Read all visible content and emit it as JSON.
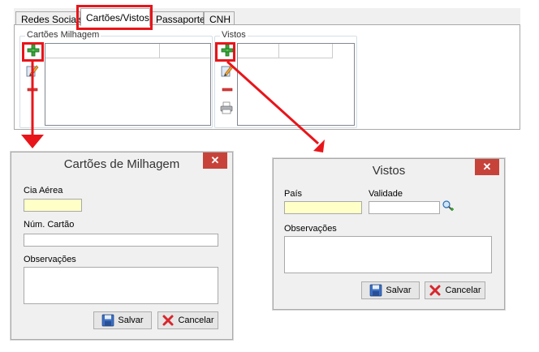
{
  "tabs": [
    {
      "label": "Redes Sociais"
    },
    {
      "label": "Cartões/Vistos"
    },
    {
      "label": "Passaportes"
    },
    {
      "label": "CNH"
    }
  ],
  "panel": {
    "milhagem_group_title": "Cartões Milhagem",
    "vistos_group_title": "Vistos"
  },
  "dialog_milhagem": {
    "title": "Cartões de Milhagem",
    "close": "✕",
    "cia_aerea_label": "Cia Aérea",
    "cia_aerea_value": "",
    "num_cartao_label": "Núm. Cartão",
    "num_cartao_value": "",
    "observacoes_label": "Observações",
    "observacoes_value": "",
    "save_label": "Salvar",
    "cancel_label": "Cancelar"
  },
  "dialog_vistos": {
    "title": "Vistos",
    "close": "✕",
    "pais_label": "País",
    "pais_value": "",
    "validade_label": "Validade",
    "validade_value": "",
    "observacoes_label": "Observações",
    "observacoes_value": "",
    "save_label": "Salvar",
    "cancel_label": "Cancelar"
  },
  "colors": {
    "annotation": "#e8151a",
    "required_field": "#ffffc8",
    "close_button": "#c7433a"
  }
}
